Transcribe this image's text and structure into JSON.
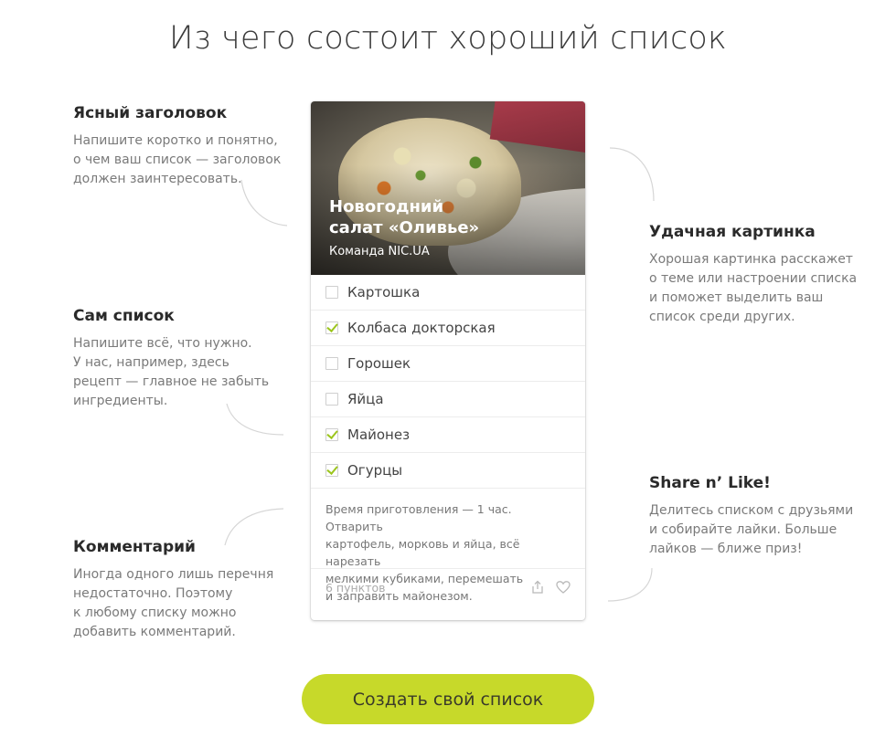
{
  "page": {
    "title": "Из чего состоит хороший список"
  },
  "features": {
    "title": {
      "heading": "Ясный заголовок",
      "text": "Напишите коротко и понятно,\nо чем ваш список — заголовок\nдолжен заинтересовать."
    },
    "list": {
      "heading": "Сам список",
      "text": "Напишите всё, что нужно.\nУ нас, например, здесь\nрецепт — главное не забыть\nингредиенты."
    },
    "comment": {
      "heading": "Комментарий",
      "text": "Иногда одного лишь перечня\nнедостаточно. Поэтому\nк любому списку можно\nдобавить комментарий."
    },
    "image": {
      "heading": "Удачная картинка",
      "text": "Хорошая картинка расскажет\nо теме или настроении списка\nи поможет выделить ваш\nсписок среди других."
    },
    "share": {
      "heading": "Share n’ Like!",
      "text": "Делитесь списком с друзьями\nи собирайте лайки. Больше\nлайков — ближе приз!"
    }
  },
  "card": {
    "title": "Новогодний\nсалат «Оливье»",
    "author": "Команда NIC.UA",
    "items": [
      {
        "label": "Картошка",
        "checked": false
      },
      {
        "label": "Колбаса докторская",
        "checked": true
      },
      {
        "label": "Горошек",
        "checked": false
      },
      {
        "label": "Яйца",
        "checked": false
      },
      {
        "label": "Майонез",
        "checked": true
      },
      {
        "label": "Огурцы",
        "checked": true
      }
    ],
    "comment": "Время приготовления — 1 час. Отварить\nкартофель, морковь и яйца, всё нарезать\nмелкими кубиками, перемешать\nи заправить майонезом.",
    "count_label": "6 пунктов",
    "icons": {
      "share": "share-icon",
      "like": "heart-icon"
    }
  },
  "cta": {
    "label": "Создать свой список"
  },
  "colors": {
    "accent": "#c7d92a",
    "check": "#9cc51e",
    "connector": "#d6d6d6"
  }
}
